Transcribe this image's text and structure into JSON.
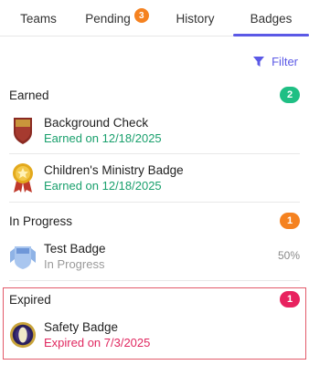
{
  "tabs": [
    {
      "label": "Teams"
    },
    {
      "label": "Pending",
      "badge": "3"
    },
    {
      "label": "History"
    },
    {
      "label": "Badges"
    }
  ],
  "filter": {
    "label": "Filter",
    "icon": "filter-icon"
  },
  "sections": {
    "earned": {
      "title": "Earned",
      "count": "2",
      "color": "#1fbf84",
      "items": [
        {
          "name": "Background Check",
          "sub": "Earned on 12/18/2025",
          "icon": "shield-badge-icon"
        },
        {
          "name": "Children's Ministry Badge",
          "sub": "Earned on 12/18/2025",
          "icon": "star-medal-icon"
        }
      ]
    },
    "in_progress": {
      "title": "In Progress",
      "count": "1",
      "color": "#f58220",
      "items": [
        {
          "name": "Test Badge",
          "sub": "In Progress",
          "progress": "50%",
          "icon": "ribbon-badge-icon"
        }
      ]
    },
    "expired": {
      "title": "Expired",
      "count": "1",
      "color": "#e8225f",
      "items": [
        {
          "name": "Safety Badge",
          "sub": "Expired on 7/3/2025",
          "icon": "round-badge-icon"
        }
      ]
    }
  },
  "colors": {
    "accent": "#5b59e6",
    "green": "#1aa06d",
    "pink": "#e0275f"
  }
}
